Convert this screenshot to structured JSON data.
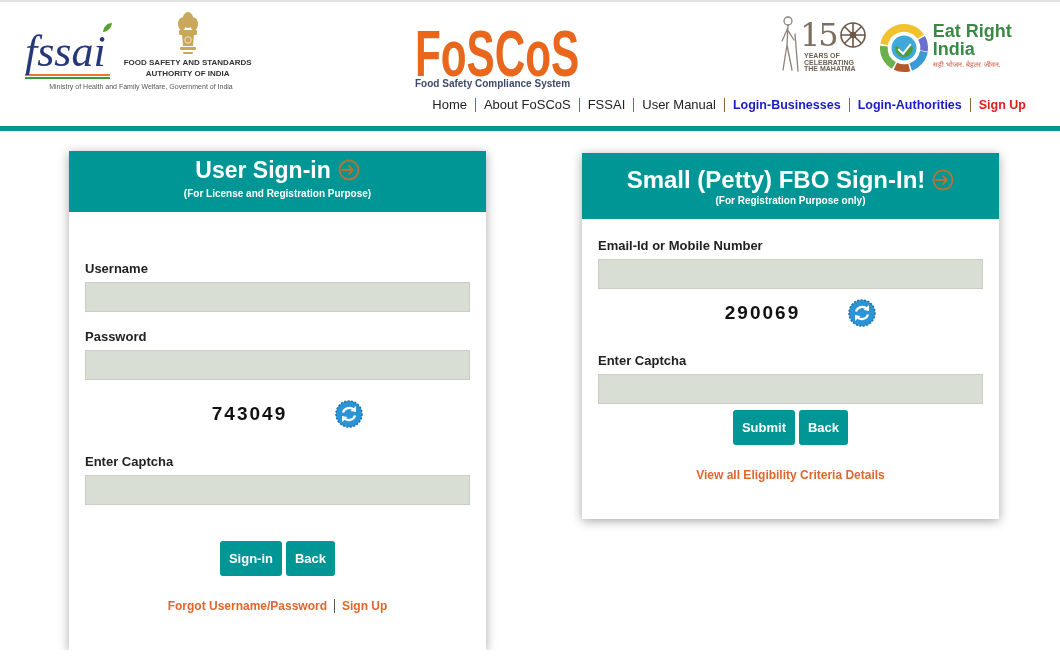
{
  "header": {
    "fssai_logo": {
      "wordmark": "fssai",
      "title_lines": [
        "FOOD SAFETY AND STANDARDS",
        "AUTHORITY OF INDIA"
      ],
      "ministry": "Ministry of Health and Family Welfare, Government of India"
    },
    "foscos_logo": {
      "wordmark": "FoSCoS",
      "tagline": "Food Safety Compliance System"
    },
    "anniversary_logo": {
      "number": "15",
      "caption_lines": [
        "YEARS OF",
        "CELEBRATING",
        "THE MAHATMA"
      ]
    },
    "eat_right_logo": {
      "title_lines": [
        "Eat Right",
        "India"
      ],
      "tagline": "सही भोजन. बेहतर जीवन."
    },
    "nav": [
      {
        "label": "Home",
        "kind": "plain"
      },
      {
        "label": "About FoSCoS",
        "kind": "plain"
      },
      {
        "label": "FSSAI",
        "kind": "plain"
      },
      {
        "label": "User Manual",
        "kind": "plain"
      },
      {
        "label": "Login-Businesses",
        "kind": "login"
      },
      {
        "label": "Login-Authorities",
        "kind": "login"
      },
      {
        "label": "Sign Up",
        "kind": "signup"
      }
    ]
  },
  "panels": [
    {
      "title": "User Sign-in",
      "subtitle": "(For License and Registration Purpose)",
      "fields": [
        {
          "kind": "input",
          "label": "Username"
        },
        {
          "kind": "input",
          "label": "Password"
        },
        {
          "kind": "captcha",
          "code": "743049"
        },
        {
          "kind": "input",
          "label": "Enter Captcha"
        }
      ],
      "buttons": [
        "Sign-in",
        "Back"
      ],
      "links": [
        "Forgot Username/Password",
        "Sign Up"
      ]
    },
    {
      "title": "Small (Petty) FBO Sign-In!",
      "subtitle": "(For Registration Purpose only)",
      "fields": [
        {
          "kind": "input",
          "label": "Email-Id or Mobile Number"
        },
        {
          "kind": "captcha",
          "code": "290069"
        },
        {
          "kind": "input",
          "label": "Enter Captcha"
        }
      ],
      "buttons": [
        "Submit",
        "Back"
      ],
      "links": [
        "View all Eligibility Criteria Details"
      ]
    }
  ]
}
